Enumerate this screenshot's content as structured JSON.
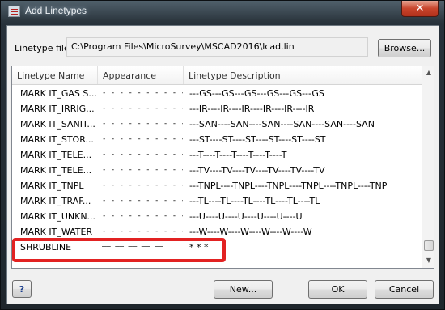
{
  "window": {
    "title": "Add Linetypes",
    "close_label": "✕"
  },
  "file": {
    "label": "Linetype file:",
    "path": "C:\\Program Files\\MicroSurvey\\MSCAD2016\\lcad.lin",
    "browse_label": "Browse..."
  },
  "list": {
    "headers": [
      "Linetype Name",
      "Appearance",
      "Linetype Description"
    ],
    "rows": [
      {
        "name": "MARK IT_GAS S...",
        "appearance": "- - - - - - - - - - - - - -",
        "description": "---GS---GS---GS---GS---GS---GS"
      },
      {
        "name": "MARK IT_IRRIG...",
        "appearance": "- - - - - - - - - - - - - -",
        "description": "---IR----IR----IR----IR----IR----IR"
      },
      {
        "name": "MARK IT_SANIT...",
        "appearance": "- - - - - - - - - - - - - -",
        "description": "---SAN----SAN----SAN----SAN----SAN----SAN"
      },
      {
        "name": "MARK IT_STOR...",
        "appearance": "- - - - - - - - - - - - - -",
        "description": "---ST----ST----ST----ST----ST----ST"
      },
      {
        "name": "MARK IT_TELE...",
        "appearance": "- - - - - - - - - - - - - -",
        "description": "---T----T----T----T----T----T"
      },
      {
        "name": "MARK IT_TELE...",
        "appearance": "- - - - - - - - - - - - - -",
        "description": "---TV----TV----TV----TV----TV----TV"
      },
      {
        "name": "MARK IT_TNPL",
        "appearance": "- - - - - - - - - - - - - -",
        "description": "---TNPL----TNPL----TNPL----TNPL----TNPL----TNP"
      },
      {
        "name": "MARK IT_TRAF...",
        "appearance": "- - - - - - - - - - - - - -",
        "description": "---TL----TL----TL----TL----TL----TL"
      },
      {
        "name": "MARK IT_UNKN...",
        "appearance": "- - - - - - - - - - - - - -",
        "description": "---U----U----U----U----U----U"
      },
      {
        "name": "MARK IT_WATER",
        "appearance": "- - - - - - - - - - - - - -",
        "description": "---W----W----W----W----W----W"
      },
      {
        "name": "SHRUBLINE",
        "appearance": "—— —— —— —— ——",
        "description": "* * *"
      }
    ]
  },
  "buttons": {
    "help": "?",
    "new": "New...",
    "ok": "OK",
    "cancel": "Cancel"
  },
  "colors": {
    "highlight": "#e22222"
  }
}
